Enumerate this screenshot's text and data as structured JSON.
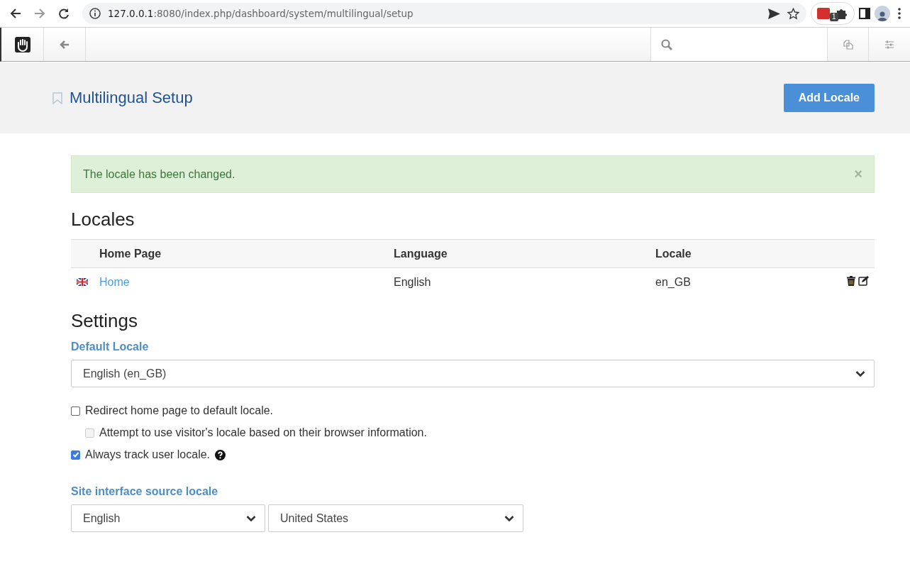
{
  "browser": {
    "url_host": "127.0.0.1",
    "url_path": ":8080/index.php/dashboard/system/multilingual/setup",
    "extension_badge": "1"
  },
  "header": {
    "title": "Multilingual Setup",
    "action": "Add Locale"
  },
  "alert": {
    "message": "The locale has been changed.",
    "close": "×"
  },
  "locales": {
    "heading": "Locales",
    "columns": [
      "Home Page",
      "Language",
      "Locale"
    ],
    "rows": [
      {
        "home_page": "Home",
        "language": "English",
        "locale": "en_GB"
      }
    ]
  },
  "settings": {
    "heading": "Settings",
    "default_locale_label": "Default Locale",
    "default_locale_value": "English (en_GB)",
    "options": [
      {
        "label": "Redirect home page to default locale.",
        "checked": false,
        "disabled": false,
        "help": false,
        "children": [
          {
            "label": "Attempt to use visitor's locale based on their browser information.",
            "checked": false,
            "disabled": true,
            "help": false
          }
        ]
      },
      {
        "label": "Always track user locale.",
        "checked": true,
        "disabled": false,
        "help": true
      }
    ],
    "source_locale_label": "Site interface source locale",
    "source_language": "English",
    "source_country": "United States"
  }
}
